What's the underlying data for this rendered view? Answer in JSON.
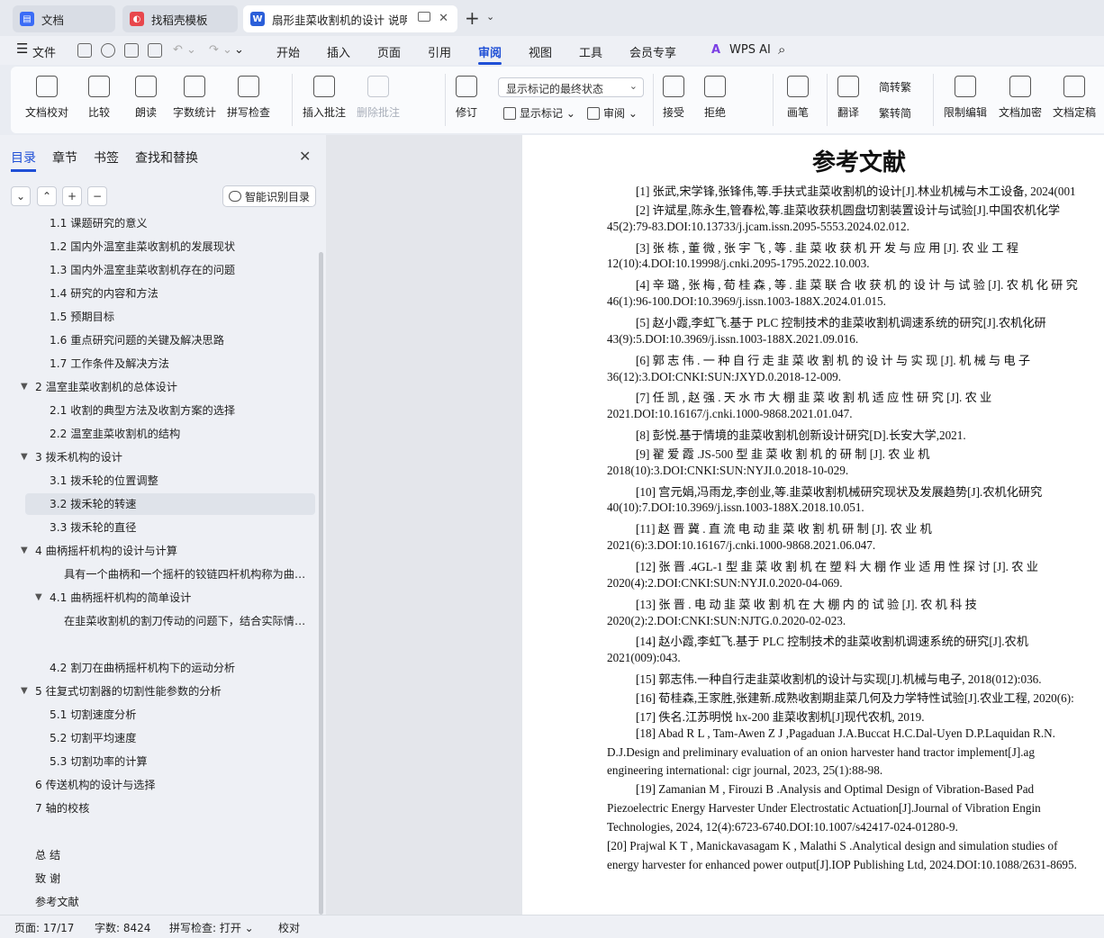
{
  "tabs": [
    {
      "label": "文档",
      "icon": "docs-app-icon",
      "color": "#3b6cf6"
    },
    {
      "label": "找稻壳模板",
      "icon": "docer-icon",
      "color": "#e8474c"
    },
    {
      "label": "扇形韭菜收割机的设计 说明书",
      "icon": "word-doc-icon",
      "color": "#2b5fd9"
    }
  ],
  "menu": {
    "file": "文件",
    "items": [
      "开始",
      "插入",
      "页面",
      "引用",
      "审阅",
      "视图",
      "工具",
      "会员专享"
    ],
    "active": "审阅",
    "wps_ai": "WPS AI"
  },
  "ribbon": {
    "doc_check": "文档校对",
    "compare": "比较",
    "read_aloud": "朗读",
    "word_count": "字数统计",
    "spell_check": "拼写检查",
    "insert_comment": "插入批注",
    "delete_comment": "删除批注",
    "revise": "修订",
    "show_mode": "显示标记的最终状态",
    "show_marks": "显示标记",
    "review": "审阅",
    "accept": "接受",
    "reject": "拒绝",
    "brush": "画笔",
    "translate": "翻译",
    "trad": "简转繁",
    "simp": "繁转简",
    "restrict_edit": "限制编辑",
    "doc_encrypt": "文档加密",
    "doc_final": "文档定稿"
  },
  "panel": {
    "tabs": [
      "目录",
      "章节",
      "书签",
      "查找和替换"
    ],
    "smart_btn": "智能识别目录",
    "toc": [
      {
        "text": "1.1 课题研究的意义",
        "level": 2
      },
      {
        "text": "1.2 国内外温室韭菜收割机的发展现状",
        "level": 2
      },
      {
        "text": "1.3 国内外温室韭菜收割机存在的问题",
        "level": 2
      },
      {
        "text": "1.4 研究的内容和方法",
        "level": 2
      },
      {
        "text": "1.5 预期目标",
        "level": 2
      },
      {
        "text": "1.6 重点研究问题的关键及解决思路",
        "level": 2
      },
      {
        "text": "1.7 工作条件及解决方法",
        "level": 2
      },
      {
        "text": "2 温室韭菜收割机的总体设计",
        "level": 1,
        "expanded": true
      },
      {
        "text": "2.1 收割的典型方法及收割方案的选择",
        "level": 2
      },
      {
        "text": "2.2 温室韭菜收割机的结构",
        "level": 2
      },
      {
        "text": "3 拨禾机构的设计",
        "level": 1,
        "expanded": true
      },
      {
        "text": "3.1 拨禾轮的位置调整",
        "level": 2
      },
      {
        "text": "3.2 拨禾轮的转速",
        "level": 2,
        "selected": true
      },
      {
        "text": "3.3  拨禾轮的直径",
        "level": 2
      },
      {
        "text": "4 曲柄摇杆机构的设计与计算",
        "level": 1,
        "expanded": true
      },
      {
        "text": "具有一个曲柄和一个摇杆的铰链四杆机构称为曲柄摇杆机构",
        "level": 3
      },
      {
        "text": "4.1 曲柄摇杆机构的简单设计",
        "level": 2,
        "expanded": true
      },
      {
        "text": "在韭菜收割机的割刀传动的问题下，结合实际情况与所学知识",
        "level": 3
      },
      {
        "text": "",
        "level": 3
      },
      {
        "text": "4.2 割刀在曲柄摇杆机构下的运动分析",
        "level": 2
      },
      {
        "text": "5 往复式切割器的切割性能参数的分析",
        "level": 1,
        "expanded": true
      },
      {
        "text": "5.1 切割速度分析",
        "level": 2
      },
      {
        "text": "5.2 切割平均速度",
        "level": 2
      },
      {
        "text": "5.3 切割功率的计算",
        "level": 2
      },
      {
        "text": "6 传送机构的设计与选择",
        "level": 1
      },
      {
        "text": "7  轴的校核",
        "level": 1
      },
      {
        "text": "",
        "level": 1
      },
      {
        "text": "总  结",
        "level": 1
      },
      {
        "text": "致  谢",
        "level": 1
      },
      {
        "text": "参考文献",
        "level": 1
      }
    ]
  },
  "document": {
    "title": "参考文献",
    "lines": [
      {
        "t": "[1] 张武,宋学锋,张锋伟,等.手扶式韭菜收割机的设计[J].林业机械与木工设备, 2024(001",
        "indent": true
      },
      {
        "t": "[2] 许斌星,陈永生,管春松,等.韭菜收获机圆盘切割装置设计与试验[J].中国农机化学",
        "indent": true
      },
      {
        "t": "45(2):79-83.DOI:10.13733/j.jcam.issn.2095-5553.2024.02.012.",
        "indent": false
      },
      {
        "t": "[3] 张 栋 , 董 微 , 张 宇 飞 , 等 . 韭 菜 收 获 机 开 发 与 应 用 [J]. 农 业 工 程",
        "indent": true
      },
      {
        "t": "12(10):4.DOI:10.19998/j.cnki.2095-1795.2022.10.003.",
        "indent": false
      },
      {
        "t": "[4] 辛 璐 , 张 梅 , 荀 桂 森 , 等 . 韭 菜 联 合 收 获 机 的 设 计 与 试 验 [J]. 农 机 化 研 究",
        "indent": true
      },
      {
        "t": "46(1):96-100.DOI:10.3969/j.issn.1003-188X.2024.01.015.",
        "indent": false
      },
      {
        "t": "[5] 赵小霞,李虹飞.基于 PLC 控制技术的韭菜收割机调速系统的研究[J].农机化研",
        "indent": true
      },
      {
        "t": "43(9):5.DOI:10.3969/j.issn.1003-188X.2021.09.016.",
        "indent": false
      },
      {
        "t": "[6] 郭 志 伟 . 一 种 自 行 走 韭 菜 收 割 机 的 设 计 与 实 现 [J]. 机 械 与 电 子",
        "indent": true
      },
      {
        "t": "36(12):3.DOI:CNKI:SUN:JXYD.0.2018-12-009.",
        "indent": false
      },
      {
        "t": "[7]  任 凯 , 赵 强 . 天 水 市 大 棚 韭 菜 收 割 机 适 应 性 研 究 [J]. 农 业",
        "indent": true
      },
      {
        "t": "2021.DOI:10.16167/j.cnki.1000-9868.2021.01.047.",
        "indent": false
      },
      {
        "t": "[8] 彭悦.基于情境的韭菜收割机创新设计研究[D].长安大学,2021.",
        "indent": true
      },
      {
        "t": "[9]   翟 爱 霞  .JS-500  型  韭  菜  收  割  机  的  研  制  [J].  农  业  机",
        "indent": true
      },
      {
        "t": "2018(10):3.DOI:CNKI:SUN:NYJI.0.2018-10-029.",
        "indent": false
      },
      {
        "t": "[10] 宫元娟,冯雨龙,李创业,等.韭菜收割机械研究现状及发展趋势[J].农机化研究",
        "indent": true
      },
      {
        "t": "40(10):7.DOI:10.3969/j.issn.1003-188X.2018.10.051.",
        "indent": false
      },
      {
        "t": "[11]   赵  晋  冀  .  直  流  电  动  韭  菜  收  割  机  研  制  [J].  农  业  机",
        "indent": true
      },
      {
        "t": "2021(6):3.DOI:10.16167/j.cnki.1000-9868.2021.06.047.",
        "indent": false
      },
      {
        "t": "[12]  张 晋 .4GL-1  型 韭 菜 收 割 机 在 塑 料 大 棚 作 业 适 用 性 探 讨 [J]. 农 业",
        "indent": true
      },
      {
        "t": "2020(4):2.DOI:CNKI:SUN:NYJI.0.2020-04-069.",
        "indent": false
      },
      {
        "t": "[13]  张 晋 . 电 动 韭 菜 收 割 机 在 大 棚 内 的 试 验 [J]. 农 机 科 技",
        "indent": true
      },
      {
        "t": "2020(2):2.DOI:CNKI:SUN:NJTG.0.2020-02-023.",
        "indent": false
      },
      {
        "t": "[14] 赵小霞,李虹飞.基于 PLC 控制技术的韭菜收割机调速系统的研究[J].农机",
        "indent": true
      },
      {
        "t": "2021(009):043.",
        "indent": false
      },
      {
        "t": "[15] 郭志伟.一种自行走韭菜收割机的设计与实现[J].机械与电子, 2018(012):036.",
        "indent": true
      },
      {
        "t": "[16] 荀桂森,王家胜,张建新.成熟收割期韭菜几何及力学特性试验[J].农业工程, 2020(6):",
        "indent": true
      },
      {
        "t": "[17] 佚名.江苏明悦 hx-200 韭菜收割机[J]现代农机, 2019.",
        "indent": true
      },
      {
        "t": "[18]    Abad R L , Tam-Awen Z J ,Pagaduan J.A.Buccat H.C.Dal-Uyen D.P.Laquidan R.N.",
        "indent": true
      },
      {
        "t": "D.J.Design  and  preliminary  evaluation  of  an  onion  harvester  hand  tractor  implement[J].ag",
        "indent": false
      },
      {
        "t": "engineering international: cigr journal, 2023, 25(1):88-98.",
        "indent": false
      },
      {
        "t": "[19]    Zamanian  M , Firouzi B .Analysis  and  Optimal  Design  of  Vibration-Based  Pad",
        "indent": true
      },
      {
        "t": "Piezoelectric  Energy  Harvester  Under  Electrostatic  Actuation[J].Journal  of  Vibration  Engin",
        "indent": false
      },
      {
        "t": "Technologies, 2024, 12(4):6723-6740.DOI:10.1007/s42417-024-01280-9.",
        "indent": false
      },
      {
        "t": "[20]    Prajwal K T , Manickavasagam K , Malathi S .Analytical design and simulation studies of",
        "indent": false
      },
      {
        "t": "energy harvester for enhanced power output[J].IOP Publishing Ltd, 2024.DOI:10.1088/2631-8695.",
        "indent": false
      }
    ]
  },
  "status": {
    "page": "页面: 17/17",
    "words": "字数: 8424",
    "spell": "拼写检查: 打开",
    "proof": "校对"
  }
}
